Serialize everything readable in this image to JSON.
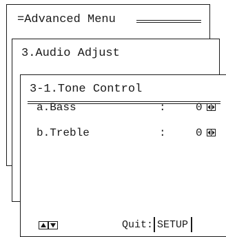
{
  "menus": {
    "advanced": {
      "title": "=Advanced Menu"
    },
    "audio": {
      "title": "3.Audio Adjust"
    },
    "tone": {
      "title": "3-1.Tone Control",
      "rows": [
        {
          "label": "a.Bass",
          "separator": ":",
          "value": "0",
          "icon": "left-right-arrows-icon"
        },
        {
          "label": "b.Treble",
          "separator": ":",
          "value": "0",
          "icon": "left-right-arrows-icon"
        }
      ],
      "footer": {
        "nav_icon": "up-down-arrows-icon",
        "quit_label": "Quit:",
        "setup_key": "SETUP"
      }
    }
  }
}
